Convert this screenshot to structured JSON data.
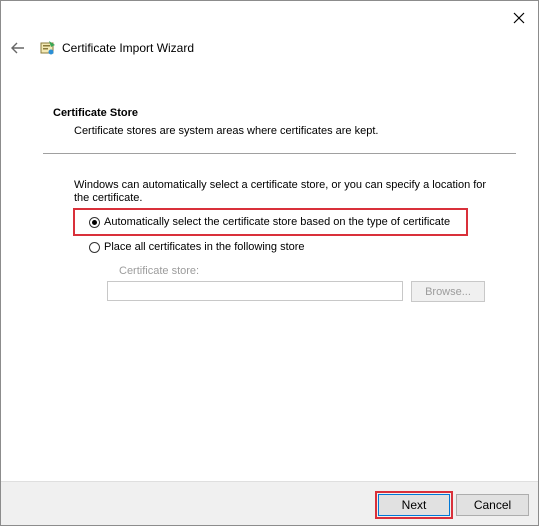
{
  "window": {
    "title": "Certificate Import Wizard"
  },
  "section": {
    "title": "Certificate Store",
    "description": "Certificate stores are system areas where certificates are kept."
  },
  "intro_text": "Windows can automatically select a certificate store, or you can specify a location for the certificate.",
  "options": {
    "auto": {
      "label": "Automatically select the certificate store based on the type of certificate",
      "selected": true
    },
    "manual": {
      "label": "Place all certificates in the following store",
      "selected": false
    }
  },
  "store_field": {
    "label": "Certificate store:",
    "value": "",
    "browse_label": "Browse..."
  },
  "footer": {
    "next_label": "Next",
    "cancel_label": "Cancel"
  },
  "colors": {
    "highlight": "#d9303a",
    "focus_border": "#0078d7"
  },
  "icons": {
    "close": "close-icon",
    "back": "back-arrow-icon",
    "wizard": "certificate-icon"
  }
}
